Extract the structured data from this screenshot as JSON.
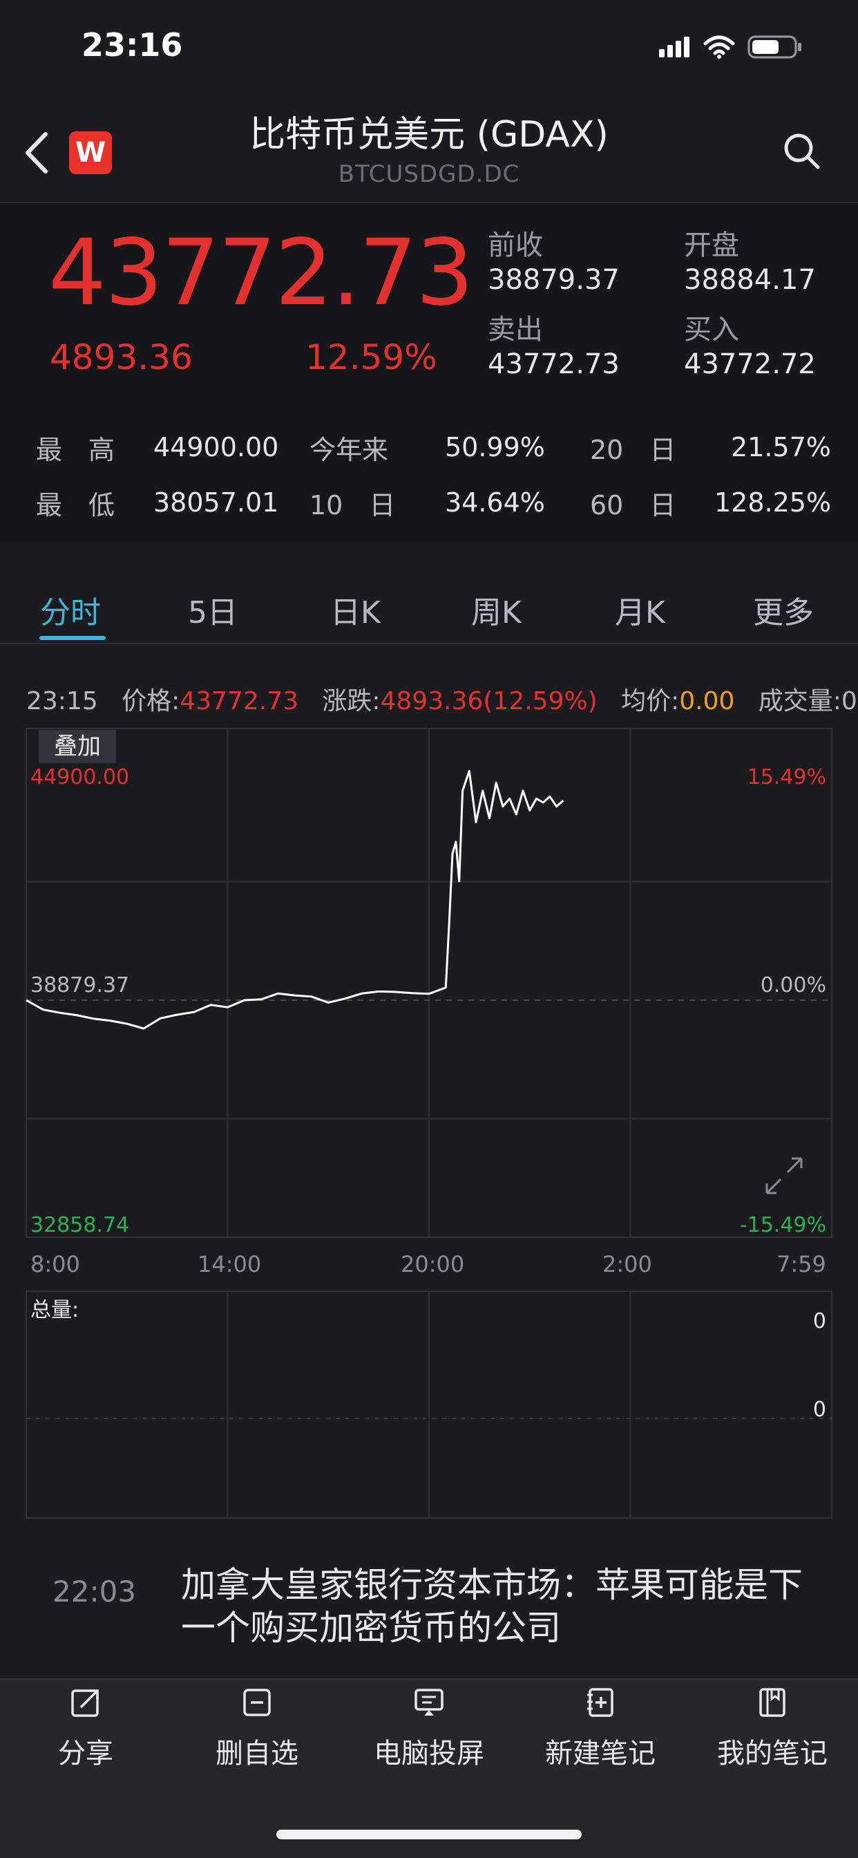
{
  "status": {
    "time": "23:16"
  },
  "header": {
    "title": "比特币兑美元 (GDAX)",
    "subtitle": "BTCUSDGD.DC",
    "logo_letter": "W"
  },
  "quote": {
    "price": "43772.73",
    "change": "4893.36",
    "change_pct": "12.59%",
    "prev_close_label": "前收",
    "prev_close": "38879.37",
    "open_label": "开盘",
    "open": "38884.17",
    "ask_label": "卖出",
    "ask": "43772.73",
    "bid_label": "买入",
    "bid": "43772.72"
  },
  "stats": {
    "high_label": "最　高",
    "high": "44900.00",
    "low_label": "最　低",
    "low": "38057.01",
    "ytd_label": "今年来",
    "ytd": "50.99%",
    "d10_label": "10　日",
    "d10": "34.64%",
    "d20_label": "20　日",
    "d20": "21.57%",
    "d60_label": "60　日",
    "d60": "128.25%"
  },
  "tabs": [
    {
      "label": "分时",
      "active": true
    },
    {
      "label": "5日"
    },
    {
      "label": "日K"
    },
    {
      "label": "周K"
    },
    {
      "label": "月K"
    },
    {
      "label": "更多"
    }
  ],
  "info": {
    "time": "23:15",
    "price_label": "价格:",
    "price": "43772.73",
    "change_label": "涨跌:",
    "change": "4893.36(12.59%)",
    "avg_label": "均价:",
    "avg": "0.00",
    "volume_label": "成交量:",
    "volume": "0"
  },
  "chart": {
    "overlay_button": "叠加",
    "volume_label": "总量:",
    "volume_ticks": [
      "0",
      "0"
    ],
    "expand_icon": "expand-icon"
  },
  "chart_data": {
    "type": "line",
    "title": "",
    "xlabel": "",
    "ylabel": "",
    "x_ticks": [
      "8:00",
      "14:00",
      "20:00",
      "2:00",
      "7:59"
    ],
    "y_labels_left": [
      "44900.00",
      "38879.37",
      "32858.74"
    ],
    "y_labels_right": [
      "15.49%",
      "0.00%",
      "-15.49%"
    ],
    "ylim": [
      32858.74,
      44900.0
    ],
    "reference": 38879.37,
    "series": [
      {
        "x_hours": [
          0,
          0.5,
          1,
          1.5,
          2,
          2.5,
          3,
          3.5,
          4,
          4.5,
          5,
          5.5,
          6,
          6.5,
          7,
          7.5,
          8,
          8.5,
          9,
          9.5,
          10,
          10.5,
          11,
          11.5,
          12,
          12.5,
          12.6,
          12.7,
          12.8,
          12.9,
          13.0,
          13.2,
          13.4,
          13.6,
          13.8,
          14.0,
          14.2,
          14.4,
          14.6,
          14.8,
          15.0,
          15.2,
          15.4,
          15.6,
          15.8,
          16.0
        ],
        "values": [
          38879,
          38640,
          38560,
          38500,
          38410,
          38360,
          38280,
          38160,
          38420,
          38510,
          38580,
          38760,
          38700,
          38880,
          38900,
          39050,
          39000,
          38970,
          38820,
          38920,
          39050,
          39100,
          39090,
          39060,
          39040,
          39200,
          40800,
          42600,
          42900,
          41900,
          44200,
          44700,
          43400,
          44200,
          43500,
          44400,
          43800,
          44000,
          43600,
          44200,
          43700,
          44000,
          43900,
          44050,
          43800,
          43950
        ]
      }
    ]
  },
  "news": {
    "time": "22:03",
    "text": "加拿大皇家银行资本市场：苹果可能是下一个购买加密货币的公司"
  },
  "bottom_bar": [
    {
      "label": "分享",
      "icon": "share-icon"
    },
    {
      "label": "删自选",
      "icon": "remove-watchlist-icon"
    },
    {
      "label": "电脑投屏",
      "icon": "screen-cast-icon"
    },
    {
      "label": "新建笔记",
      "icon": "new-note-icon"
    },
    {
      "label": "我的笔记",
      "icon": "my-notes-icon"
    }
  ]
}
